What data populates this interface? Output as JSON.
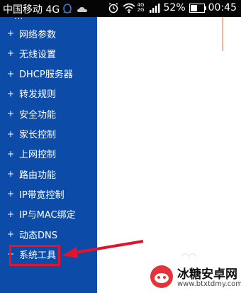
{
  "status_bar": {
    "carrier": "中国移动 4G",
    "signal_net_top": "4G",
    "signal_net_bottom": "2G",
    "battery_percent_label": "52%",
    "battery_level": 0.52,
    "time": "00:45",
    "icons": [
      "qq-icon",
      "cloud-icon",
      "alarm-icon",
      "wifi-icon",
      "signal-icon",
      "battery-icon"
    ]
  },
  "sidebar": {
    "partial_top_item": "...",
    "items": [
      {
        "label": "网络参数"
      },
      {
        "label": "无线设置"
      },
      {
        "label": "DHCP服务器"
      },
      {
        "label": "转发规则"
      },
      {
        "label": "安全功能"
      },
      {
        "label": "家长控制"
      },
      {
        "label": "上网控制"
      },
      {
        "label": "路由功能"
      },
      {
        "label": "IP带宽控制"
      },
      {
        "label": "IP与MAC绑定"
      },
      {
        "label": "动态DNS"
      },
      {
        "label": "系统工具"
      }
    ],
    "highlighted_item": "系统工具"
  },
  "annotation": {
    "highlight_color": "#e2142b",
    "arrow_color": "#e2142b"
  },
  "watermark": {
    "title": "冰糖安卓网",
    "url": "www.btxtdmy.com"
  },
  "colors": {
    "sidebar_bg": "#0c4ca8",
    "status_bar_bg": "#050505"
  }
}
